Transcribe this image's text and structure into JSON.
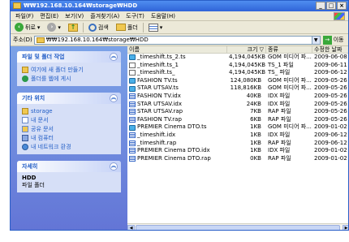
{
  "window": {
    "title": "₩₩192.168.10.164₩storage₩HDD",
    "minimize": "_",
    "maximize": "□",
    "close": "×"
  },
  "menu": [
    "파일(F)",
    "편집(E)",
    "보기(V)",
    "즐겨찾기(A)",
    "도구(T)",
    "도움말(H)"
  ],
  "toolbar": {
    "back_label": "뒤로",
    "search_label": "검색",
    "folders_label": "폴더"
  },
  "address": {
    "label": "주소(D)",
    "value": "₩₩192.168.10.164₩storage₩HDD",
    "go_label": "이동"
  },
  "left_pane": {
    "file_tasks": {
      "title": "파일 및 폴더 작업",
      "items": [
        "여기에 새 폴더 만들기",
        "폴더를 웹에 게시"
      ]
    },
    "other_places": {
      "title": "기타 위치",
      "items": [
        "storage",
        "내 문서",
        "공유 문서",
        "내 컴퓨터",
        "내 네트워크 환경"
      ]
    },
    "details": {
      "title": "자세히",
      "name": "HDD",
      "type": "파일 폴더"
    }
  },
  "columns": {
    "name": "이름",
    "size": "크기 ▽",
    "type": "종류",
    "date": "수정한 날짜"
  },
  "files": [
    {
      "name": "_timeshift.ts_2.ts",
      "size": "4,194,045KB",
      "type": "GOM 미디어 파...",
      "date": "2009-06-08",
      "icon": "media"
    },
    {
      "name": "_timeshift.ts_1",
      "size": "4,194,045KB",
      "type": "TS_1 파일",
      "date": "2009-06-11",
      "icon": "doc"
    },
    {
      "name": "_timeshift.ts_",
      "size": "4,194,045KB",
      "type": "TS_ 파일",
      "date": "2009-06-12",
      "icon": "doc"
    },
    {
      "name": "FASHION TV.ts",
      "size": "124,080KB",
      "type": "GOM 미디어 파...",
      "date": "2009-05-26",
      "icon": "media"
    },
    {
      "name": "STAR UTSAV.ts",
      "size": "118,816KB",
      "type": "GOM 미디어 파...",
      "date": "2009-05-26",
      "icon": "media"
    },
    {
      "name": "FASHION TV.idx",
      "size": "40KB",
      "type": "IDX 파일",
      "date": "2009-05-26",
      "icon": "doc-blue"
    },
    {
      "name": "STAR UTSAV.idx",
      "size": "24KB",
      "type": "IDX 파일",
      "date": "2009-05-26",
      "icon": "doc-blue"
    },
    {
      "name": "STAR UTSAV.rap",
      "size": "7KB",
      "type": "RAP 파일",
      "date": "2009-05-26",
      "icon": "doc-blue"
    },
    {
      "name": "FASHION TV.rap",
      "size": "6KB",
      "type": "RAP 파일",
      "date": "2009-05-26",
      "icon": "doc-blue"
    },
    {
      "name": "PREMIER Cinema DTO.ts",
      "size": "1KB",
      "type": "GOM 미디어 파...",
      "date": "2009-01-02",
      "icon": "media"
    },
    {
      "name": "_timeshift.idx",
      "size": "1KB",
      "type": "IDX 파일",
      "date": "2009-06-12",
      "icon": "doc-blue"
    },
    {
      "name": "_timeshift.rap",
      "size": "1KB",
      "type": "RAP 파일",
      "date": "2009-06-12",
      "icon": "doc-blue"
    },
    {
      "name": "PREMIER Cinema DTO.idx",
      "size": "1KB",
      "type": "IDX 파일",
      "date": "2009-01-02",
      "icon": "doc-blue"
    },
    {
      "name": "PREMIER Cinema DTO.rap",
      "size": "0KB",
      "type": "RAP 파일",
      "date": "2009-01-02",
      "icon": "doc-blue"
    }
  ]
}
